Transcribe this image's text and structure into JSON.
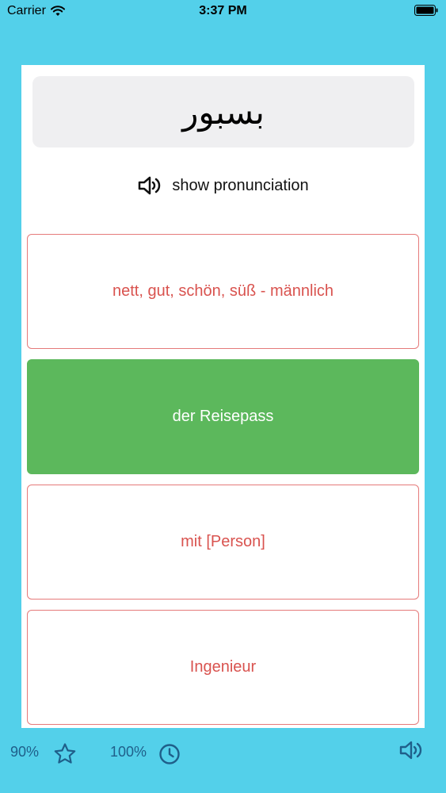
{
  "status": {
    "carrier": "Carrier",
    "time": "3:37 PM"
  },
  "card": {
    "word": "بسبور",
    "pronunciation_label": "show pronunciation",
    "options": [
      {
        "label": "nett, gut, schön, süß - männlich",
        "state": "default"
      },
      {
        "label": "der Reisepass",
        "state": "correct"
      },
      {
        "label": "mit [Person]",
        "state": "default"
      },
      {
        "label": "Ingenieur",
        "state": "default"
      }
    ]
  },
  "bottom": {
    "accuracy": "90%",
    "progress": "100%"
  },
  "colors": {
    "background": "#53d0ea",
    "correct": "#5cb85c",
    "incorrect_text": "#d9534f",
    "icon": "#1f5f8a"
  },
  "icons": {
    "wifi": "wifi-icon",
    "battery": "battery-icon",
    "speaker": "speaker-icon",
    "star": "star-icon",
    "clock": "clock-icon"
  }
}
